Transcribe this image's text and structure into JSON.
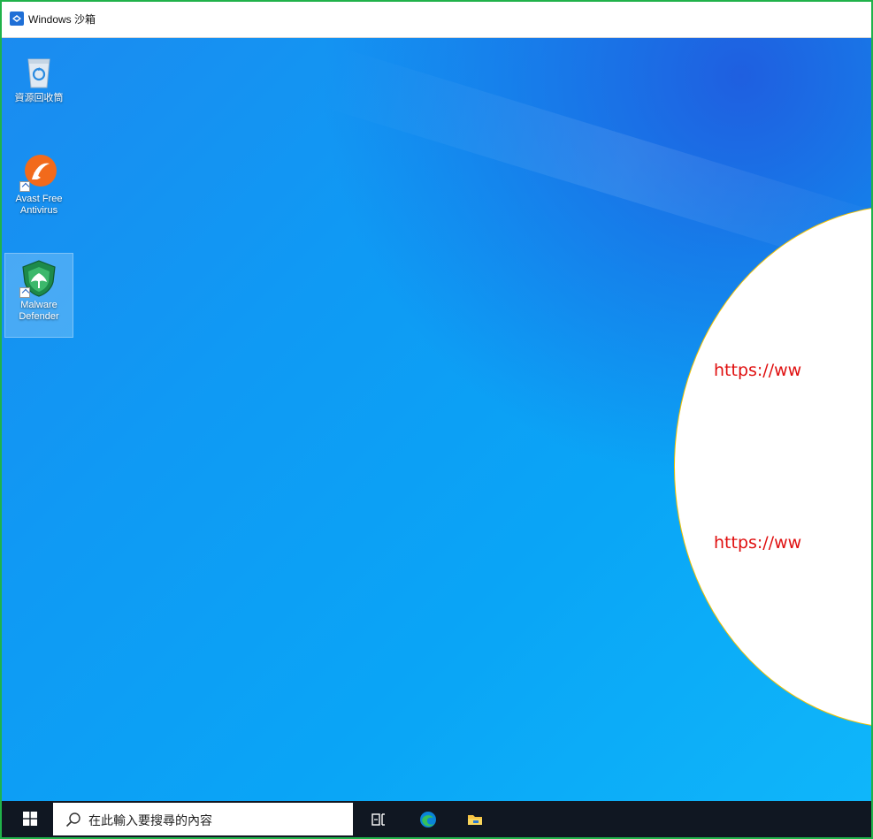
{
  "window": {
    "title": "Windows 沙箱",
    "border_color": "#20b24a"
  },
  "desktop": {
    "icons": [
      {
        "label": "資源回收筒",
        "icon": "recycle-bin-icon"
      },
      {
        "label": "Avast Free Antivirus",
        "icon": "avast-icon",
        "shortcut": true
      },
      {
        "label": "Malware Defender",
        "icon": "malware-defender-icon",
        "shortcut": true,
        "selected": true
      }
    ]
  },
  "callout": {
    "urls": [
      "https://ww",
      "https://ww"
    ],
    "url_color": "#e01010",
    "border_color": "#f2c200"
  },
  "taskbar": {
    "search_placeholder": "在此輸入要搜尋的內容",
    "icons": [
      "windows-start-icon",
      "search-icon",
      "task-view-icon",
      "edge-icon",
      "file-explorer-icon"
    ]
  }
}
